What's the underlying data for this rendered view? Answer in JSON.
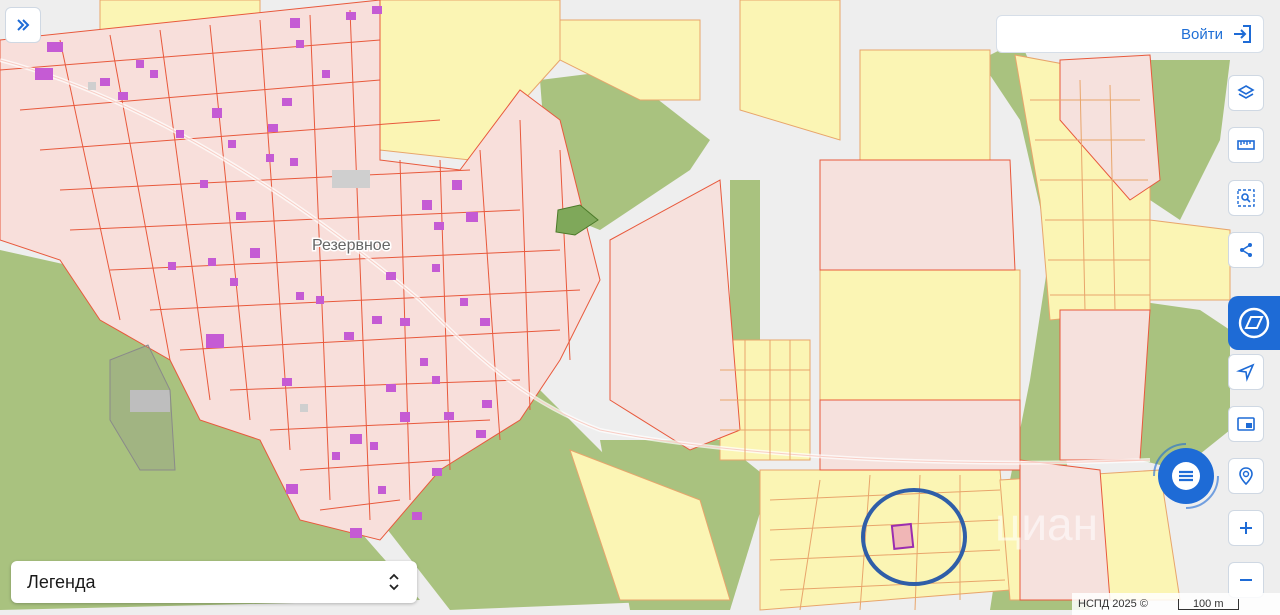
{
  "map": {
    "place_label": "Резервное",
    "watermark": "циан"
  },
  "header": {
    "login_label": "Войти"
  },
  "legend": {
    "label": "Легенда"
  },
  "attribution": {
    "text": "НСПД 2025 ©",
    "scale": "100 m"
  },
  "toolbar": {
    "buttons": [
      "layers-icon",
      "ruler-icon",
      "area-search-icon",
      "share-icon",
      "nspd-logo-icon",
      "locate-icon",
      "minimap-icon",
      "geo-search-icon",
      "zoom-in-icon",
      "zoom-out-icon"
    ]
  },
  "colors": {
    "accent": "#1e6bd6",
    "forest": "#a7c27e",
    "yellow_field": "#fbf5b5",
    "pink_parcel": "#f7e0dc",
    "parcel_border": "#e8593c",
    "building": "#c55bd4",
    "highlight_ring": "#2f5ea8"
  }
}
